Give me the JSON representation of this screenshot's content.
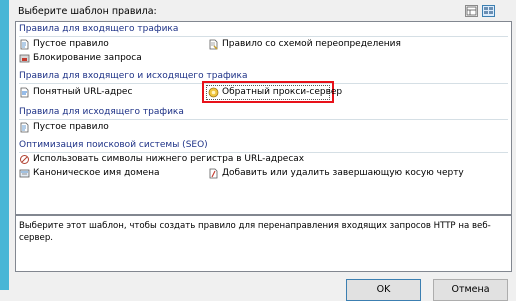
{
  "dialog": {
    "prompt": "Выберите шаблон правила:",
    "view_icons": [
      "details-view-icon",
      "tiles-view-icon"
    ]
  },
  "groups": [
    {
      "title": "Правила для входящего трафика",
      "items": [
        {
          "label": "Пустое правило",
          "icon": "blank-rule-icon"
        },
        {
          "label": "Правило со схемой переопределения",
          "icon": "rewrite-map-icon"
        },
        {
          "label": "Блокирование запроса",
          "icon": "block-request-icon"
        }
      ]
    },
    {
      "title": "Правила для входящего и исходящего трафика",
      "items": [
        {
          "label": "Понятный URL-адрес",
          "icon": "user-friendly-url-icon"
        },
        {
          "label": "Обратный прокси-сервер",
          "icon": "reverse-proxy-icon",
          "selected": true
        }
      ]
    },
    {
      "title": "Правила для исходящего трафика",
      "items": [
        {
          "label": "Пустое правило",
          "icon": "blank-rule-icon"
        }
      ]
    },
    {
      "title": "Оптимизация поисковой системы (SEO)",
      "items": [
        {
          "label": "Использовать символы нижнего регистра в URL-адресах",
          "icon": "lowercase-icon"
        },
        {
          "label": "Каноническое имя домена",
          "icon": "canonical-domain-icon"
        },
        {
          "label": "Добавить или удалить завершающую косую черту",
          "icon": "trailing-slash-icon"
        }
      ]
    }
  ],
  "description": "Выберите этот шаблон, чтобы создать правило для перенаправления входящих запросов HTTP на веб-сервер.",
  "buttons": {
    "ok": "OK",
    "cancel": "Отмена"
  },
  "colors": {
    "highlight": "#e8121a",
    "group_header": "#1e3287",
    "window_edge": "#48b6d6"
  }
}
